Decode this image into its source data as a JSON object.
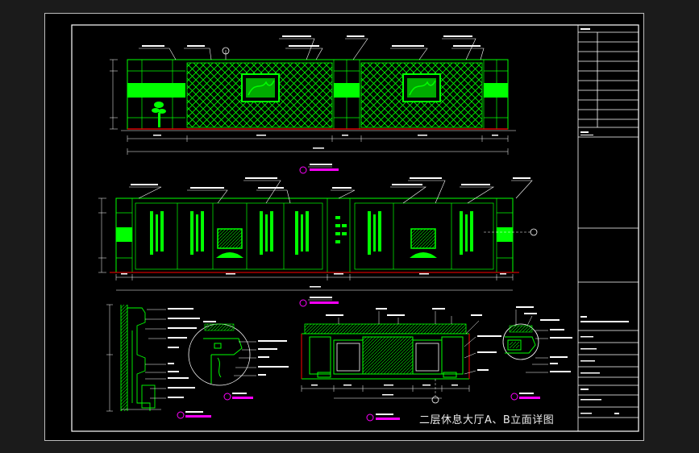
{
  "sheet": {
    "title": "二层休息大厅A、B立面详图"
  },
  "colors": {
    "background": "#000000",
    "outer": "#1b1b1b",
    "line_green": "#00ff00",
    "line_white": "#ffffff",
    "line_red": "#ff0000",
    "line_magenta": "#ff00ff",
    "line_yellow": "#ffff00"
  },
  "views": [
    {
      "name": "elevation-a",
      "icon": "section-marker-icon"
    },
    {
      "name": "elevation-b",
      "icon": "section-marker-icon"
    },
    {
      "name": "section",
      "icon": "section-marker-icon"
    },
    {
      "name": "detail-1",
      "icon": "section-marker-icon"
    },
    {
      "name": "section-2",
      "icon": "section-marker-icon"
    },
    {
      "name": "detail-2",
      "icon": "section-marker-icon"
    }
  ]
}
